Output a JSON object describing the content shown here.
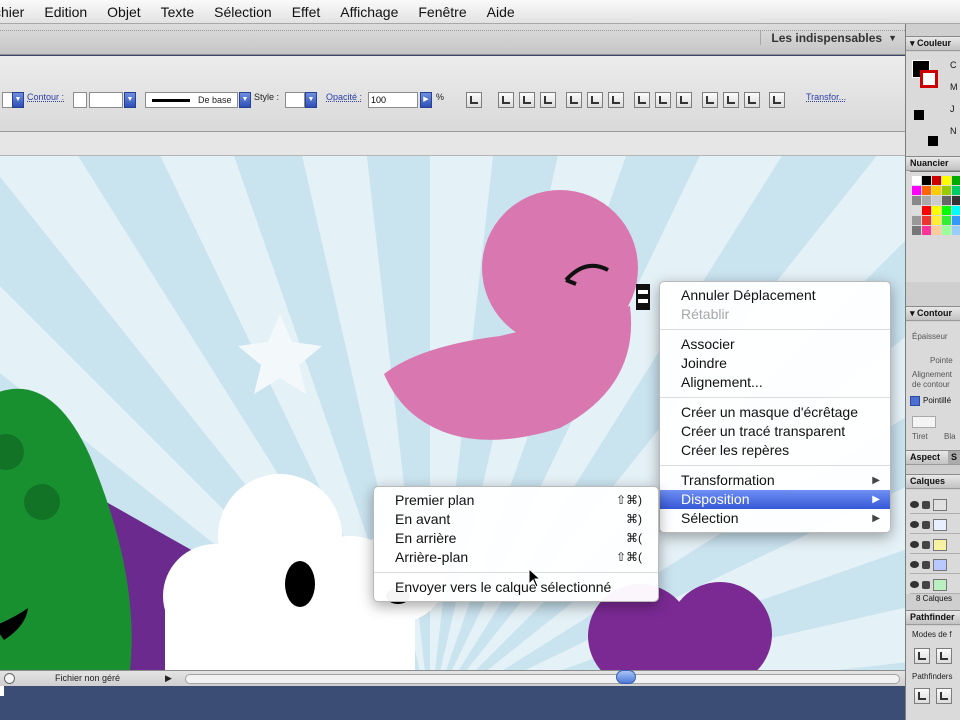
{
  "menubar": {
    "items": [
      "chier",
      "Edition",
      "Objet",
      "Texte",
      "Sélection",
      "Effet",
      "Affichage",
      "Fenêtre",
      "Aide"
    ]
  },
  "appbar": {
    "workspace": "Les indispensables",
    "workspace_arrow": "▼"
  },
  "control": {
    "contour_label": "Contour :",
    "stroke_profile": "De base",
    "style_label": "Style :",
    "opacity_label": "Opacité :",
    "opacity_value": "100",
    "opacity_unit": "%",
    "transform_label": "Transfor..."
  },
  "panels": {
    "couleur": "Couleur",
    "couleur_letters": [
      "C",
      "M",
      "J",
      "N"
    ],
    "nuancier": "Nuancier",
    "contour": "Contour",
    "epaisseur": "Épaisseur",
    "pointe": "Pointe",
    "alignement": "Alignement de contour",
    "pointille": "Pointillé",
    "tiret": "Tiret",
    "blanc": "Bla",
    "aspect": "Aspect",
    "aspect_tab2": "S",
    "calques": "Calques",
    "calques_count": "8 Calques",
    "pathfinder": "Pathfinder",
    "modes": "Modes de f",
    "pathfinders": "Pathfinders"
  },
  "status": {
    "text": "Fichier non géré",
    "arrow": "▶"
  },
  "context_menu": {
    "items": [
      {
        "label": "Annuler Déplacement",
        "enabled": true
      },
      {
        "label": "Rétablir",
        "enabled": false
      },
      {
        "sep": true
      },
      {
        "label": "Associer",
        "enabled": true
      },
      {
        "label": "Joindre",
        "enabled": true
      },
      {
        "label": "Alignement...",
        "enabled": true
      },
      {
        "sep": true
      },
      {
        "label": "Créer un masque d'écrêtage",
        "enabled": true
      },
      {
        "label": "Créer un tracé transparent",
        "enabled": true
      },
      {
        "label": "Créer les repères",
        "enabled": true
      },
      {
        "sep": true
      },
      {
        "label": "Transformation",
        "enabled": true,
        "submenu": true
      },
      {
        "label": "Disposition",
        "enabled": true,
        "submenu": true,
        "highlighted": true
      },
      {
        "label": "Sélection",
        "enabled": true,
        "submenu": true
      }
    ],
    "submenu_arrow": "▶"
  },
  "disposition_menu": {
    "items": [
      {
        "label": "Premier plan",
        "shortcut": "⇧⌘)"
      },
      {
        "label": "En avant",
        "shortcut": "⌘)"
      },
      {
        "label": "En arrière",
        "shortcut": "⌘("
      },
      {
        "label": "Arrière-plan",
        "shortcut": "⇧⌘("
      },
      {
        "sep": true
      },
      {
        "label": "Envoyer vers le calque sélectionné",
        "shortcut": ""
      }
    ]
  },
  "colors": {
    "sky": "#c9e3ef",
    "ray": "#e4f1f7",
    "bird": "#d978b0",
    "cloud": "#ffffff",
    "hill_green": "#19902f",
    "hill_purple": "#6b2a8e",
    "heart_purple": "#7b2a94",
    "menu_highlight": "#3559d7"
  }
}
